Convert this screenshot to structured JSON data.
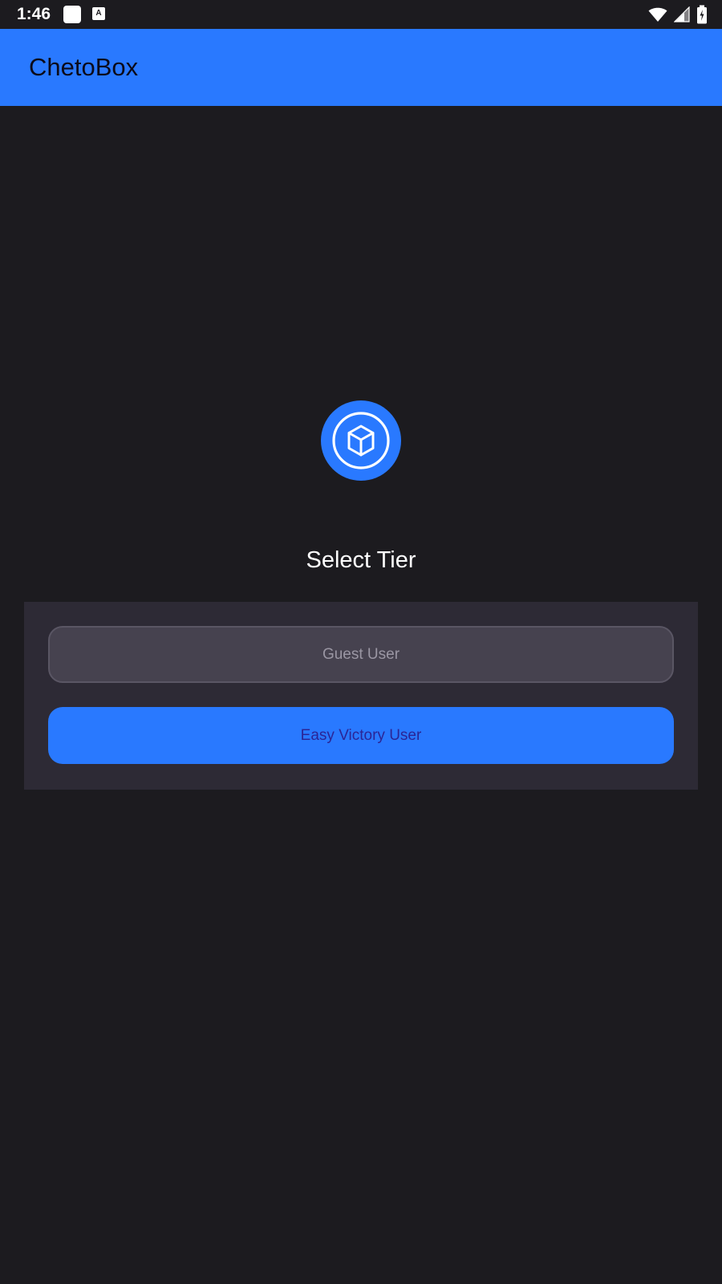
{
  "status_bar": {
    "time": "1:46",
    "notification_icon_letter": "A",
    "icons": [
      "white-square-notification-icon",
      "a-notification-icon",
      "wifi-icon",
      "cell-signal-icon",
      "battery-icon"
    ]
  },
  "app_bar": {
    "title": "ChetoBox",
    "background_color": "#2979ff"
  },
  "main": {
    "logo_icon": "cube-icon",
    "heading": "Select Tier",
    "tiers": [
      {
        "label": "Guest User",
        "state": "disabled"
      },
      {
        "label": "Easy Victory User",
        "state": "enabled"
      }
    ]
  },
  "colors": {
    "background": "#1c1b1f",
    "accent": "#2979ff",
    "card": "#2d2a35",
    "disabled_button": "#46424f"
  }
}
